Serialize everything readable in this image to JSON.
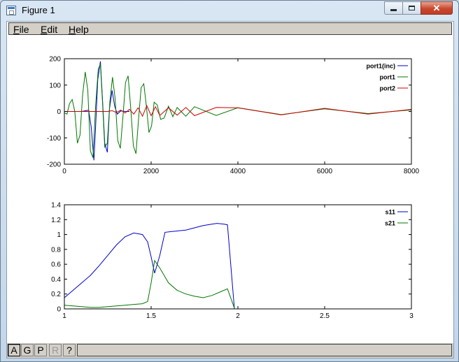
{
  "window": {
    "title": "Figure 1"
  },
  "titlebar_controls": {
    "minimize": "",
    "maximize": "",
    "close": "✕"
  },
  "menu": [
    {
      "label": "File",
      "key": "F",
      "rest": "ile"
    },
    {
      "label": "Edit",
      "key": "E",
      "rest": "dit"
    },
    {
      "label": "Help",
      "key": "H",
      "rest": "elp"
    }
  ],
  "toolbar": [
    {
      "label": "A",
      "active": true,
      "enabled": true
    },
    {
      "label": "G",
      "active": false,
      "enabled": true
    },
    {
      "label": "P",
      "active": false,
      "enabled": true
    },
    {
      "label": "R",
      "active": false,
      "enabled": false
    },
    {
      "label": "?",
      "active": false,
      "enabled": true
    }
  ],
  "colors": {
    "blue": "#0000cc",
    "green": "#007700",
    "red": "#cc0000"
  },
  "chart_data": [
    {
      "type": "line",
      "xlim": [
        0,
        8000
      ],
      "ylim": [
        -200,
        200
      ],
      "xticks": [
        "0",
        "2000",
        "4000",
        "6000",
        "8000"
      ],
      "yticks": [
        "200",
        "100",
        "0",
        "-100",
        "-200"
      ],
      "legend_position": "top-right",
      "series": [
        {
          "name": "port1(inc)",
          "color": "#0000cc",
          "x": [
            0,
            400,
            560,
            620,
            680,
            720,
            770,
            830,
            880,
            930,
            990,
            1040,
            1100,
            1160,
            1220,
            1300,
            1400,
            1500
          ],
          "y": [
            0,
            0,
            5,
            -60,
            -185,
            -60,
            120,
            190,
            40,
            -120,
            -155,
            10,
            80,
            20,
            -10,
            2,
            0,
            0
          ]
        },
        {
          "name": "port1",
          "color": "#007700",
          "x": [
            0,
            60,
            120,
            180,
            240,
            300,
            360,
            420,
            480,
            540,
            600,
            660,
            720,
            780,
            830,
            880,
            930,
            990,
            1050,
            1110,
            1170,
            1230,
            1290,
            1350,
            1410,
            1470,
            1530,
            1590,
            1650,
            1710,
            1770,
            1830,
            1890,
            1950,
            2010,
            2070,
            2140,
            2220,
            2300,
            2400,
            2500,
            2600,
            2800,
            3000,
            3500,
            4000,
            5000,
            6000,
            7000,
            8000
          ],
          "y": [
            -5,
            -10,
            30,
            45,
            0,
            -120,
            -90,
            60,
            150,
            80,
            -150,
            -175,
            20,
            160,
            180,
            30,
            -135,
            -120,
            40,
            130,
            50,
            -110,
            -140,
            -20,
            110,
            135,
            10,
            -130,
            -160,
            -30,
            90,
            105,
            20,
            -80,
            -55,
            35,
            25,
            -30,
            -25,
            20,
            -20,
            15,
            -18,
            18,
            -15,
            14,
            -12,
            10,
            -8,
            6
          ]
        },
        {
          "name": "port2",
          "color": "#cc0000",
          "x": [
            0,
            1000,
            1100,
            1200,
            1300,
            1400,
            1500,
            1600,
            1700,
            1800,
            1900,
            2000,
            2100,
            2200,
            2400,
            2600,
            2800,
            3000,
            3500,
            4000,
            5000,
            6000,
            7000,
            8000
          ],
          "y": [
            0,
            0,
            3,
            -4,
            5,
            -6,
            8,
            -10,
            14,
            -18,
            22,
            -16,
            18,
            -15,
            14,
            -14,
            15,
            -16,
            15,
            14,
            -13,
            12,
            -10,
            8
          ]
        }
      ]
    },
    {
      "type": "line",
      "xlim": [
        1,
        3
      ],
      "ylim": [
        0,
        1.4
      ],
      "xticks": [
        "1",
        "1.5",
        "2",
        "2.5",
        "3"
      ],
      "yticks": [
        "1.4",
        "1.2",
        "1",
        "0.8",
        "0.6",
        "0.4",
        "0.2",
        "0"
      ],
      "legend_position": "top-right",
      "series": [
        {
          "name": "s11",
          "color": "#0000cc",
          "x": [
            1,
            1.05,
            1.1,
            1.15,
            1.2,
            1.25,
            1.3,
            1.35,
            1.4,
            1.45,
            1.48,
            1.5,
            1.52,
            1.55,
            1.58,
            1.62,
            1.7,
            1.75,
            1.8,
            1.85,
            1.88,
            1.92,
            1.94,
            1.98
          ],
          "y": [
            0.15,
            0.25,
            0.35,
            0.45,
            0.58,
            0.72,
            0.86,
            0.97,
            1.02,
            1.0,
            0.9,
            0.7,
            0.48,
            0.72,
            1.03,
            1.04,
            1.06,
            1.09,
            1.12,
            1.14,
            1.15,
            1.14,
            1.13,
            0.0
          ]
        },
        {
          "name": "s21",
          "color": "#007700",
          "x": [
            1,
            1.1,
            1.15,
            1.2,
            1.25,
            1.3,
            1.35,
            1.4,
            1.45,
            1.48,
            1.5,
            1.52,
            1.55,
            1.6,
            1.65,
            1.7,
            1.75,
            1.8,
            1.85,
            1.9,
            1.94,
            1.98
          ],
          "y": [
            0.05,
            0.03,
            0.02,
            0.02,
            0.03,
            0.04,
            0.05,
            0.06,
            0.07,
            0.1,
            0.35,
            0.65,
            0.55,
            0.35,
            0.25,
            0.2,
            0.17,
            0.15,
            0.18,
            0.23,
            0.27,
            0.01
          ]
        }
      ]
    }
  ]
}
